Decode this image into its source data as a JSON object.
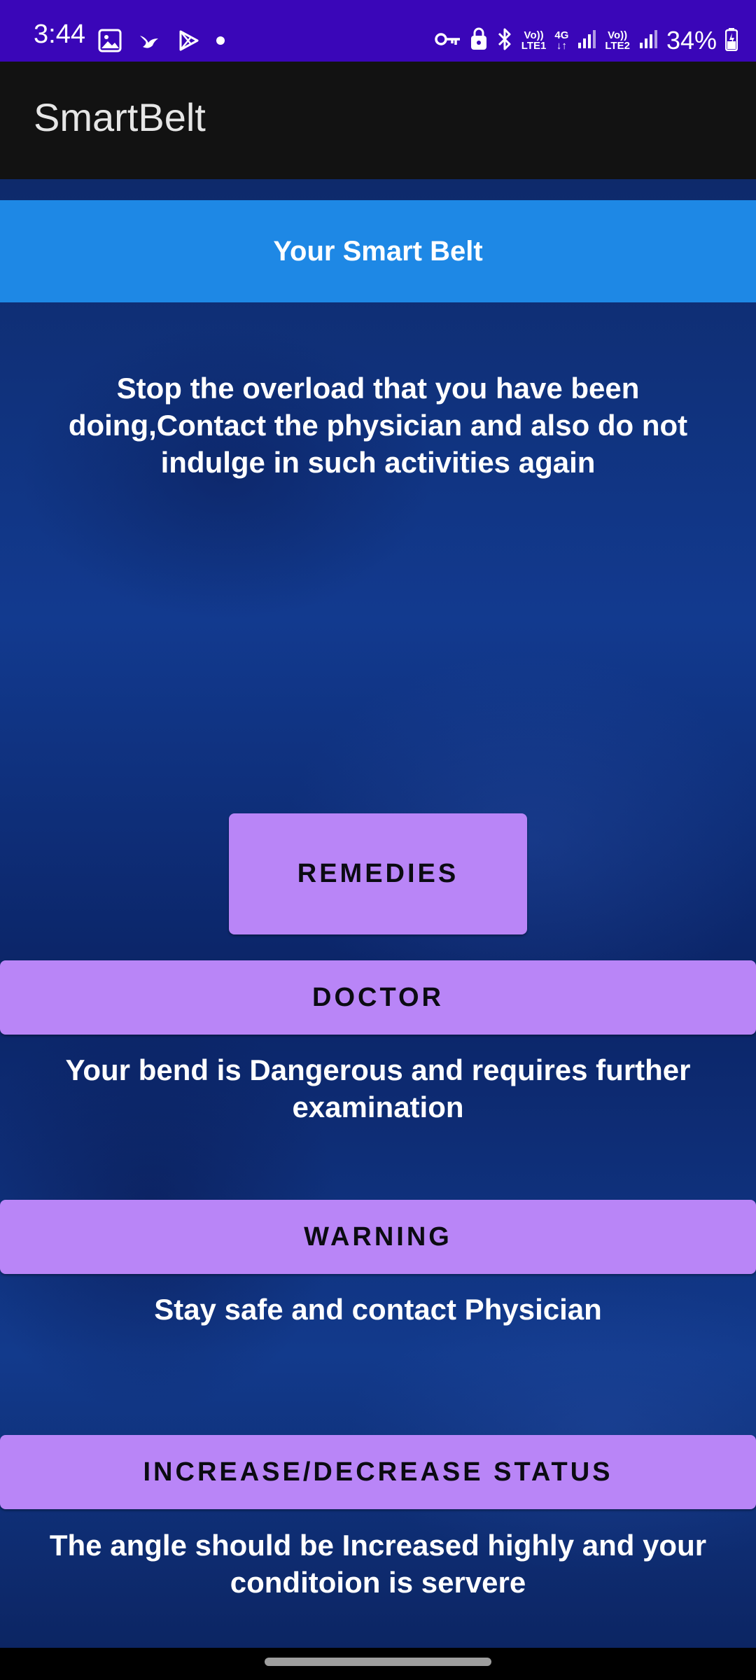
{
  "status_bar": {
    "time": "3:44",
    "left_icons": [
      "image-icon",
      "bird-icon",
      "play-store-icon",
      "dot-icon"
    ],
    "right_icons": [
      "key-icon",
      "lock-icon",
      "bluetooth-icon"
    ],
    "sim1_top": "Vo))",
    "sim1_bottom": "LTE1",
    "net_top": "4G",
    "net_bottom": "↓↑",
    "sim2_top": "Vo))",
    "sim2_bottom": "LTE2",
    "battery": "34%",
    "bg_color": "#3a06b8"
  },
  "app_bar": {
    "title": "SmartBelt"
  },
  "main": {
    "header": "Your Smart Belt",
    "overload_message": "Stop the overload that you have been doing,Contact the physician and also do not indulge in such activities again",
    "remedies_label": "REMEDIES",
    "doctor_label": "DOCTOR",
    "doctor_message": "Your bend is Dangerous and requires further examination",
    "warning_label": "WARNING",
    "warning_message": "Stay safe and contact Physician",
    "status_label": "INCREASE/DECREASE STATUS",
    "status_message": "The angle should be Increased highly and your conditoion is servere"
  },
  "colors": {
    "banner": "#1e88e5",
    "button": "#b985f7",
    "background": "#123a8f"
  }
}
